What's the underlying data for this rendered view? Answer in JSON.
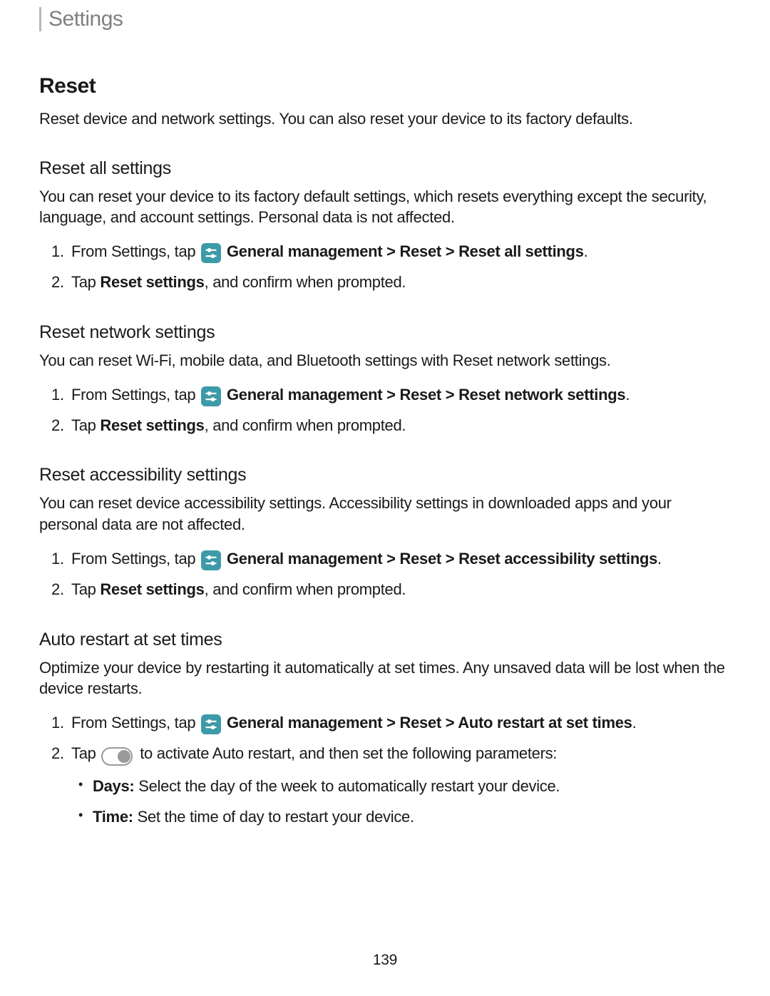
{
  "breadcrumb": "Settings",
  "page_number": "139",
  "heading": "Reset",
  "intro": "Reset device and network settings. You can also reset your device to its factory defaults.",
  "subsections": {
    "reset_all": {
      "title": "Reset all settings",
      "intro": "You can reset your device to its factory default settings, which resets everything except the security, language, and account settings. Personal data is not affected.",
      "step1_prefix": "From Settings, tap ",
      "step1_bold": "General management > Reset > Reset all settings",
      "step1_suffix": ".",
      "step2_prefix": "Tap ",
      "step2_bold": "Reset settings",
      "step2_suffix": ", and confirm when prompted."
    },
    "reset_network": {
      "title": "Reset network settings",
      "intro": "You can reset Wi-Fi, mobile data, and Bluetooth settings with Reset network settings.",
      "step1_prefix": "From Settings, tap ",
      "step1_bold": "General management > Reset > Reset network settings",
      "step1_suffix": ".",
      "step2_prefix": "Tap ",
      "step2_bold": "Reset settings",
      "step2_suffix": ", and confirm when prompted."
    },
    "reset_accessibility": {
      "title": "Reset accessibility settings",
      "intro": "You can reset device accessibility settings. Accessibility settings in downloaded apps and your personal data are not affected.",
      "step1_prefix": "From Settings, tap ",
      "step1_bold": "General management > Reset > Reset accessibility settings",
      "step1_suffix": ".",
      "step2_prefix": "Tap ",
      "step2_bold": "Reset settings",
      "step2_suffix": ", and confirm when prompted."
    },
    "auto_restart": {
      "title": "Auto restart at set times",
      "intro": "Optimize your device by restarting it automatically at set times. Any unsaved data will be lost when the device restarts.",
      "step1_prefix": "From Settings, tap ",
      "step1_bold": "General management > Reset > Auto restart at set times",
      "step1_suffix": ".",
      "step2_prefix": "Tap ",
      "step2_suffix": " to activate Auto restart, and then set the following parameters:",
      "bullets": {
        "days_label": "Days:",
        "days_text": " Select the day of the week to automatically restart your device.",
        "time_label": "Time:",
        "time_text": " Set the time of day to restart your device."
      }
    }
  }
}
